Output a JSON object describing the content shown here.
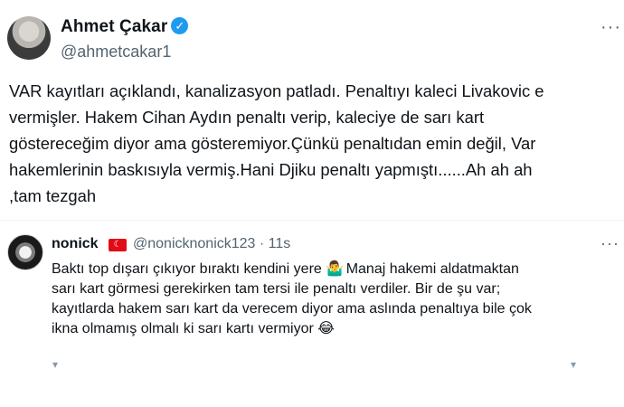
{
  "main_tweet": {
    "author_name": "Ahmet Çakar",
    "verified_glyph": "✓",
    "handle": "@ahmetcakar1",
    "more_glyph": "···",
    "text_lines": [
      "VAR kayıtları açıklandı, kanalizasyon patladı. Penaltıyı kaleci Livakovic e",
      "vermişler. Hakem Cihan Aydın penaltı verip, kaleciye de sarı kart",
      "göstereceğim diyor ama gösteremiyor.Çünkü penaltıdan emin değil, Var",
      "hakemlerinin baskısıyla vermiş.Hani Djiku penaltı yapmıştı......Ah ah ah",
      ",tam tezgah"
    ]
  },
  "reply": {
    "author_name": "nonick",
    "flag_glyph": "☾",
    "handle_time": "@nonicknonick123 · 11s",
    "more_glyph": "···",
    "line1_text": "Baktı top dışarı çıkıyor bıraktı kendini yere",
    "line1_emoji": "🤷‍♂️",
    "line1_tail": "Manaj hakemi aldatmaktan",
    "line2": "sarı kart görmesi gerekirken tam tersi ile penaltı verdiler. Bir de şu var;",
    "line3": "kayıtlarda hakem sarı kart da verecem diyor ama aslında penaltıya bile çok",
    "line4_text": "ikna olmamış olmalı ki sarı kartı vermiyor",
    "line4_emoji": "😂",
    "action_glyph": "▾"
  }
}
